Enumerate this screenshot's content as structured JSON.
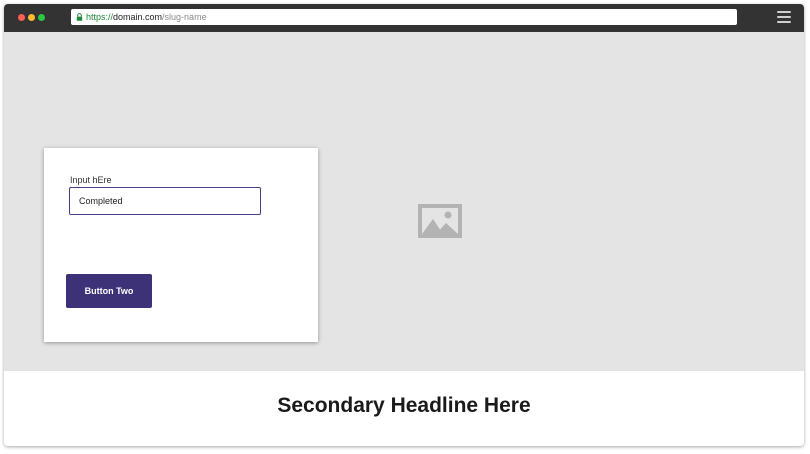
{
  "browser": {
    "url_scheme": "https://",
    "url_domain": "domain.com",
    "url_path": "/slug-name",
    "icons": {
      "lock": "lock-icon",
      "menu": "hamburger-menu-icon",
      "window_controls": [
        "close",
        "minimize",
        "maximize"
      ]
    }
  },
  "hero": {
    "background": "#e4e4e4",
    "placeholder_icon": "image-placeholder-icon"
  },
  "form": {
    "field_label": "Input hEre",
    "field_value": "Completed",
    "button_label": "Button Two",
    "accent": "#3d3277"
  },
  "footer": {
    "headline": "Secondary Headline Here"
  }
}
